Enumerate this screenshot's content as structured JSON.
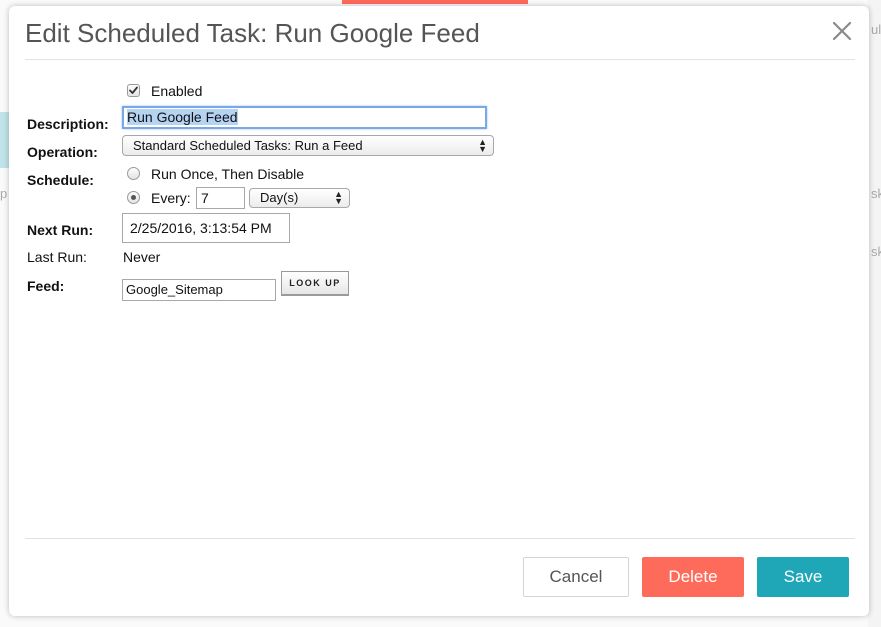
{
  "dialog": {
    "title": "Edit Scheduled Task: Run Google Feed"
  },
  "form": {
    "enabled_label": "Enabled",
    "enabled_checked": true,
    "description_label": "Description:",
    "description_value": "Run Google Feed",
    "operation_label": "Operation:",
    "operation_value": "Standard Scheduled Tasks: Run a Feed",
    "schedule_label": "Schedule:",
    "schedule_once_label": "Run Once, Then Disable",
    "schedule_every_label": "Every:",
    "schedule_every_value": "7",
    "schedule_unit_value": "Day(s)",
    "schedule_selected": "every",
    "next_run_label": "Next Run:",
    "next_run_value": "2/25/2016, 3:13:54 PM",
    "last_run_label": "Last Run:",
    "last_run_value": "Never",
    "feed_label": "Feed:",
    "feed_value": "Google_Sitemap",
    "lookup_label": "LOOK UP"
  },
  "footer": {
    "cancel_label": "Cancel",
    "delete_label": "Delete",
    "save_label": "Save"
  },
  "background": {
    "right_fragment_1": "ul",
    "right_fragment_2": "sk",
    "right_fragment_3": "sk",
    "left_fragment_1": "p"
  },
  "colors": {
    "accent_red": "#ff6b5b",
    "accent_teal": "#1fa7b8",
    "focus_blue": "#7aa7e8"
  }
}
